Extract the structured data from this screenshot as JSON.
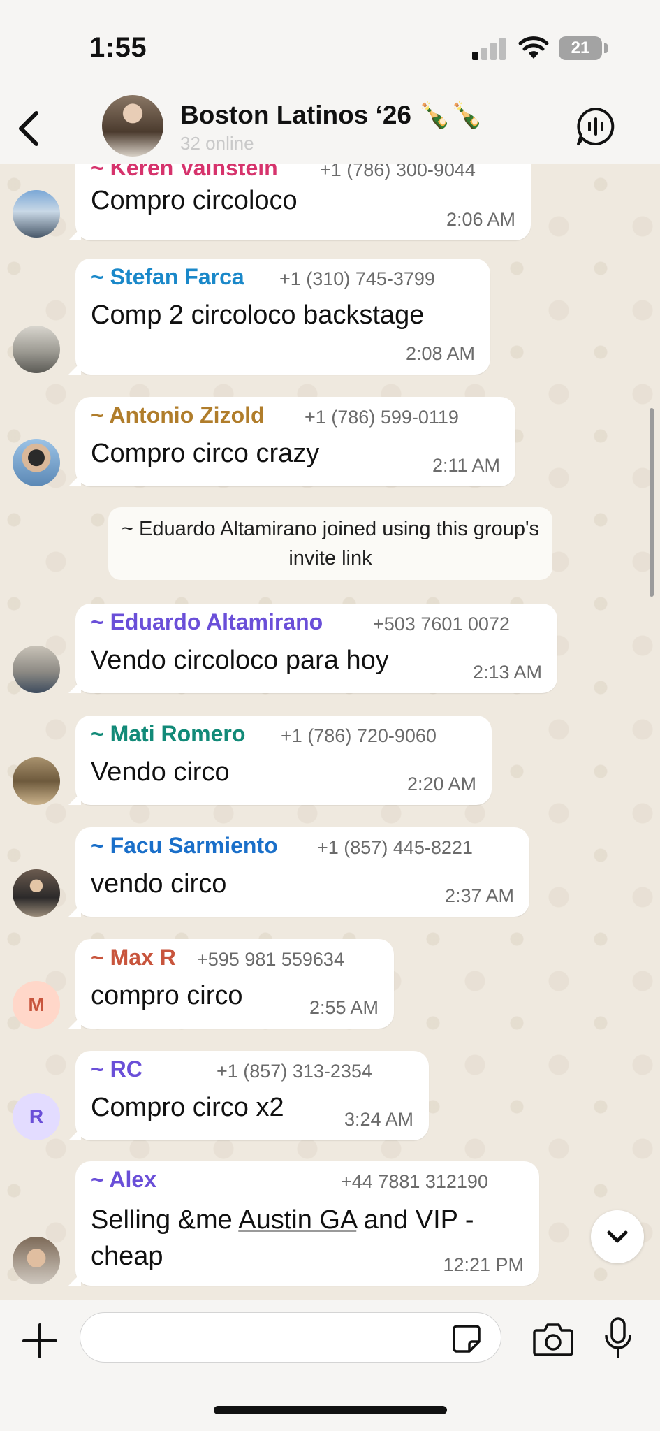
{
  "status_bar": {
    "time": "1:55",
    "battery": "21"
  },
  "header": {
    "title": "Boston Latinos ‘26 🍾🍾",
    "subtitle": "32 online"
  },
  "system_message": "~ Eduardo Altamirano joined using this group's invite link",
  "messages": [
    {
      "sender": "~ Keren Vainstein",
      "phone": "+1 (786) 300-9044",
      "text": "Compro circoloco",
      "time": "2:06 AM",
      "color": "#d6336c"
    },
    {
      "sender": "~ Stefan Farca",
      "phone": "+1 (310) 745-3799",
      "text": "Comp 2 circoloco backstage",
      "time": "2:08 AM",
      "color": "#1a88c9"
    },
    {
      "sender": "~ Antonio Zizold",
      "phone": "+1 (786) 599-0119",
      "text": "Compro circo crazy",
      "time": "2:11 AM",
      "color": "#b07d2b"
    },
    {
      "sender": "~ Eduardo Altamirano",
      "phone": "+503 7601 0072",
      "text": "Vendo circoloco para hoy",
      "time": "2:13 AM",
      "color": "#6a4fd8"
    },
    {
      "sender": "~ Mati Romero",
      "phone": "+1 (786) 720-9060",
      "text": "Vendo circo",
      "time": "2:20 AM",
      "color": "#128a78"
    },
    {
      "sender": "~ Facu Sarmiento",
      "phone": "+1 (857) 445-8221",
      "text": "vendo circo",
      "time": "2:37 AM",
      "color": "#1a6fc9"
    },
    {
      "sender": "~ Max R",
      "phone": "+595 981 559634",
      "text": "compro circo",
      "time": "2:55 AM",
      "color": "#c8553d",
      "avatar_letter": "M"
    },
    {
      "sender": "~ RC",
      "phone": "+1 (857) 313-2354",
      "text": "Compro circo x2",
      "time": "3:24 AM",
      "color": "#6a4fd8",
      "avatar_letter": "R"
    },
    {
      "sender": "~ Alex",
      "phone": "+44 7881 312190",
      "text_pre": "Selling &me ",
      "text_link": "Austin GA",
      "text_post": " and VIP - cheap",
      "time": "12:21 PM",
      "color": "#6a4fd8"
    }
  ],
  "input": {
    "placeholder": ""
  }
}
